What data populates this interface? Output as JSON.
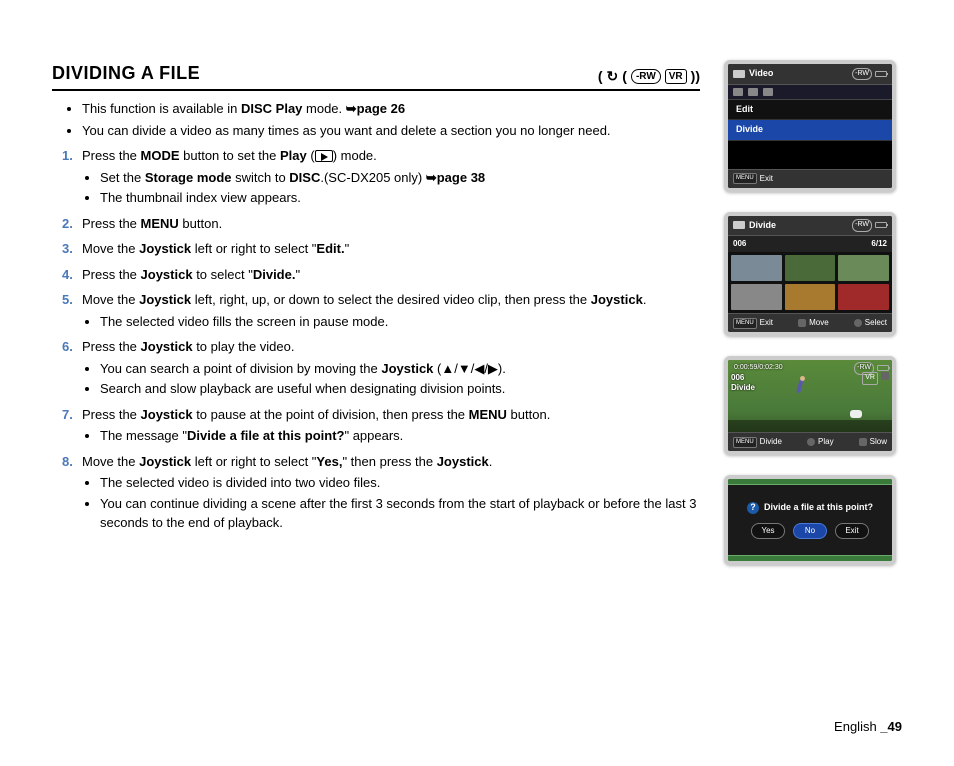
{
  "title": "DIVIDING A FILE",
  "top_badges": {
    "disc": "-RW",
    "vr": "VR"
  },
  "intro": [
    {
      "pre": "This function is available in ",
      "b": "DISC Play",
      "post": " mode. ",
      "ref": "➥page 26"
    },
    {
      "full": "You can divide a video as many times as you want and delete a section you no longer need."
    }
  ],
  "steps": [
    {
      "num": "1",
      "parts": [
        "Press the ",
        "MODE",
        " button to set the ",
        "Play",
        " (",
        "PLAYICON",
        ") mode."
      ],
      "subs": [
        {
          "pre": "Set the ",
          "b": "Storage mode",
          "mid": " switch to ",
          "b2": "DISC",
          "post": ".(SC-DX205 only) ",
          "ref": "➥page 38"
        },
        {
          "full": "The thumbnail index view appears."
        }
      ]
    },
    {
      "num": "2",
      "parts": [
        "Press the ",
        "MENU",
        " button."
      ]
    },
    {
      "num": "3",
      "parts": [
        "Move the ",
        "Joystick",
        " left or right to select \"",
        "Edit.",
        "\""
      ]
    },
    {
      "num": "4",
      "parts": [
        "Press the ",
        "Joystick",
        " to select \"",
        "Divide.",
        "\""
      ]
    },
    {
      "num": "5",
      "parts": [
        "Move the ",
        "Joystick",
        " left, right, up, or down to select the desired video clip, then press the ",
        "Joystick",
        "."
      ],
      "subs": [
        {
          "full": "The selected video fills the screen in pause mode."
        }
      ]
    },
    {
      "num": "6",
      "parts": [
        "Press the ",
        "Joystick",
        " to play the video."
      ],
      "subs": [
        {
          "pre": "You can search a point of division by moving the ",
          "b": "Joystick",
          "post": " (▲/▼/◀/▶)."
        },
        {
          "full": "Search and slow playback are useful when designating division points."
        }
      ]
    },
    {
      "num": "7",
      "parts": [
        "Press the ",
        "Joystick",
        " to pause at the point of division, then press the ",
        "MENU",
        " button."
      ],
      "subs": [
        {
          "pre": "The message \"",
          "b": "Divide a file at this point?",
          "post": "\" appears."
        }
      ]
    },
    {
      "num": "8",
      "parts": [
        "Move the ",
        "Joystick",
        " left or right to select \"",
        "Yes,",
        "\" then press the ",
        "Joystick",
        "."
      ],
      "subs": [
        {
          "full": "The selected video is divided into two video files."
        },
        {
          "full": "You can continue dividing a scene after the first 3 seconds from the start of playback or before the last 3 seconds to the end of playback."
        }
      ]
    }
  ],
  "screen1": {
    "header": "Video",
    "badge": "-RW",
    "tabs_count": 3,
    "items": [
      "Edit",
      "Divide"
    ],
    "selected": 1,
    "footer_exit": "Exit",
    "footer_menu": "MENU"
  },
  "screen2": {
    "header": "Divide",
    "badge": "-RW",
    "sub_id": "006",
    "sub_count": "6/12",
    "footer": {
      "menu": "MENU",
      "exit": "Exit",
      "move": "Move",
      "select": "Select"
    }
  },
  "screen3": {
    "time": "0:00:59/0:02:30",
    "badge": "-RW",
    "vr": "VR",
    "id": "006",
    "label": "Divide",
    "footer": {
      "menu": "MENU",
      "divide": "Divide",
      "play": "Play",
      "slow": "Slow"
    }
  },
  "screen4": {
    "question": "Divide a file at this point?",
    "buttons": [
      "Yes",
      "No",
      "Exit"
    ],
    "selected": 1
  },
  "footer": {
    "lang": "English ",
    "page": "_49"
  }
}
